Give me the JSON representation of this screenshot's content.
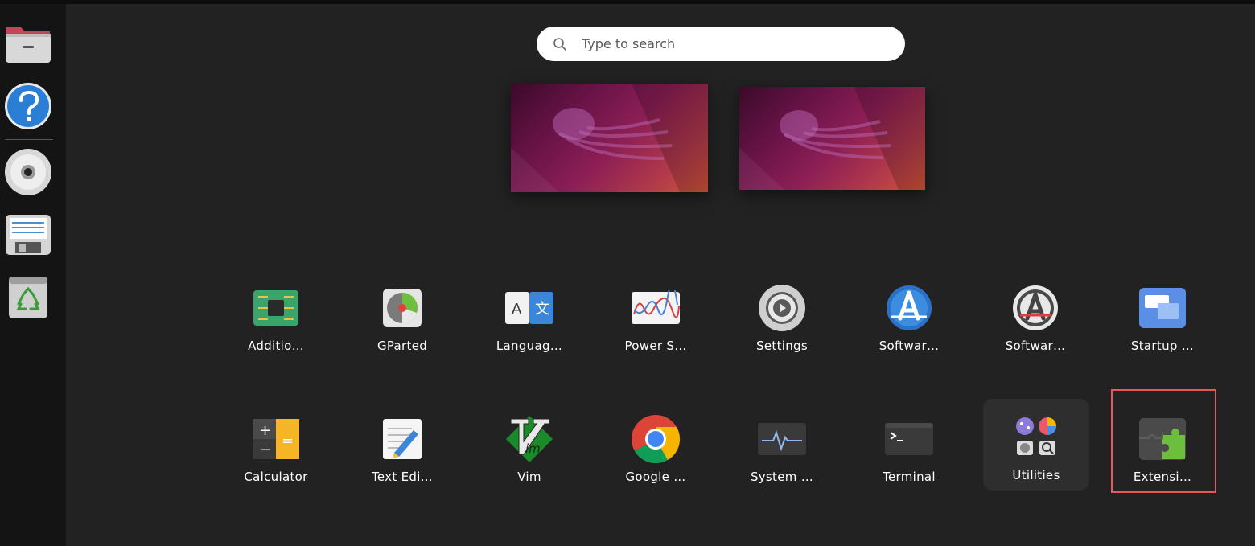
{
  "search": {
    "placeholder": "Type to search"
  },
  "dock": {
    "items": [
      {
        "name": "files",
        "icon": "folder-icon"
      },
      {
        "name": "help",
        "icon": "help-icon"
      },
      {
        "name": "disc",
        "icon": "disc-icon"
      },
      {
        "name": "floppy",
        "icon": "floppy-icon"
      },
      {
        "name": "trash",
        "icon": "trash-icon"
      }
    ]
  },
  "apps": {
    "row1": [
      {
        "label": "Additio…",
        "icon": "chip-icon"
      },
      {
        "label": "GParted",
        "icon": "gparted-icon"
      },
      {
        "label": "Languag…",
        "icon": "language-icon"
      },
      {
        "label": "Power S…",
        "icon": "power-stats-icon"
      },
      {
        "label": "Settings",
        "icon": "gear-icon"
      },
      {
        "label": "Softwar…",
        "icon": "software-store-icon"
      },
      {
        "label": "Softwar…",
        "icon": "software-updater-icon"
      },
      {
        "label": "Startup …",
        "icon": "startup-icon"
      }
    ],
    "row2": [
      {
        "label": "Calculator",
        "icon": "calculator-icon"
      },
      {
        "label": "Text Edi…",
        "icon": "text-editor-icon"
      },
      {
        "label": "Vim",
        "icon": "vim-icon"
      },
      {
        "label": "Google …",
        "icon": "chrome-icon"
      },
      {
        "label": "System …",
        "icon": "system-monitor-icon"
      },
      {
        "label": "Terminal",
        "icon": "terminal-icon"
      },
      {
        "label": "Utilities",
        "icon": "folder-grid-icon"
      },
      {
        "label": "Extensi…",
        "icon": "puzzle-icon"
      }
    ]
  },
  "colors": {
    "background": "#222222",
    "dock": "#141414",
    "highlight": "#e35a5a"
  }
}
